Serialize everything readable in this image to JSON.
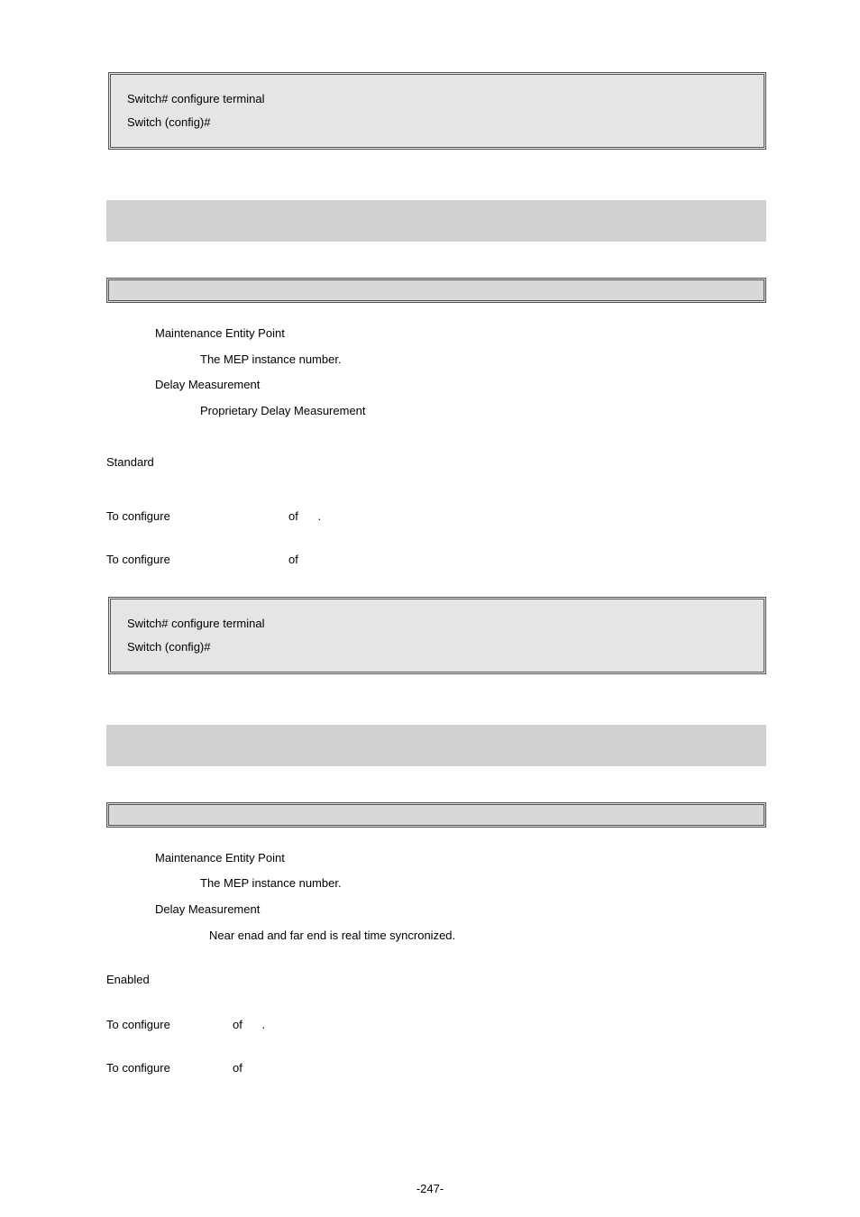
{
  "codebox1": {
    "line1": "Switch# configure terminal",
    "line2": "Switch (config)#"
  },
  "section1": {
    "p1_a": "Maintenance Entity Point",
    "p1_b": "The MEP instance number.",
    "p2_a": "Delay Measurement",
    "p2_b": "Proprietary Delay Measurement",
    "std": "Standard",
    "conf1_a": "To configure",
    "conf1_b": "of",
    "conf1_c": ".",
    "conf2_a": "To configure",
    "conf2_b": "of"
  },
  "codebox2": {
    "line1": "Switch# configure terminal",
    "line2": "Switch (config)#"
  },
  "section2": {
    "p1_a": "Maintenance Entity Point",
    "p1_b": "The MEP instance number.",
    "p2_a": "Delay Measurement",
    "p2_b": "Near enad and far end is real time syncronized.",
    "en": "Enabled",
    "conf1_a": "To configure",
    "conf1_b": "of",
    "conf1_c": ".",
    "conf2_a": "To configure",
    "conf2_b": "of"
  },
  "pagenum": "-247-"
}
